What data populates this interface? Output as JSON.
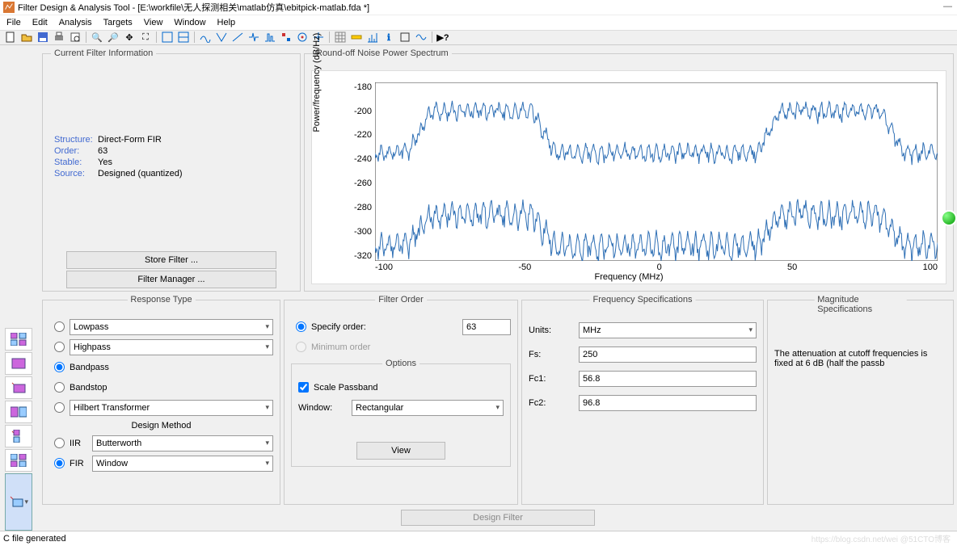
{
  "title": "Filter Design & Analysis Tool -   [E:\\workfile\\无人探测相关\\matlab仿真\\ebitpick-matlab.fda *]",
  "menu": [
    "File",
    "Edit",
    "Analysis",
    "Targets",
    "View",
    "Window",
    "Help"
  ],
  "cfi": {
    "title": "Current Filter Information",
    "structure_k": "Structure:",
    "structure_v": "Direct-Form FIR",
    "order_k": "Order:",
    "order_v": "63",
    "stable_k": "Stable:",
    "stable_v": "Yes",
    "source_k": "Source:",
    "source_v": "Designed (quantized)",
    "store": "Store Filter ...",
    "manager": "Filter Manager ..."
  },
  "plot": {
    "title": "Round-off Noise Power Spectrum",
    "ylab": "Power/frequency (dB/Hz)",
    "xlab": "Frequency (MHz)"
  },
  "rt": {
    "title": "Response Type",
    "lowpass": "Lowpass",
    "highpass": "Highpass",
    "bandpass": "Bandpass",
    "bandstop": "Bandstop",
    "hilbert": "Hilbert Transformer",
    "design_method": "Design Method",
    "iir": "IIR",
    "iir_v": "Butterworth",
    "fir": "FIR",
    "fir_v": "Window"
  },
  "fo": {
    "title": "Filter Order",
    "specify": "Specify order:",
    "specify_v": "63",
    "min": "Minimum order",
    "opts": "Options",
    "scale": "Scale Passband",
    "window": "Window:",
    "window_v": "Rectangular",
    "view": "View"
  },
  "fs": {
    "title": "Frequency Specifications",
    "units": "Units:",
    "units_v": "MHz",
    "fs_l": "Fs:",
    "fs_v": "250",
    "fc1": "Fc1:",
    "fc1_v": "56.8",
    "fc2": "Fc2:",
    "fc2_v": "96.8"
  },
  "ms": {
    "title": "Magnitude Specifications",
    "text": "The attenuation at cutoff frequencies is fixed at 6 dB (half the passb"
  },
  "design": "Design Filter",
  "status": "C file generated",
  "watermark": "https://blog.csdn.net/wei @51CTO博客",
  "chart_data": {
    "type": "line",
    "xlabel": "Frequency (MHz)",
    "ylabel": "Power/frequency (dB/Hz)",
    "xlim": [
      -125,
      125
    ],
    "ylim": [
      -330,
      -175
    ],
    "yticks": [
      -180,
      -200,
      -220,
      -240,
      -260,
      -280,
      -300,
      -320
    ],
    "xticks": [
      -100,
      -50,
      0,
      50,
      100
    ],
    "series": [
      {
        "name": "upper",
        "desc": "Upper noise envelope",
        "approx": [
          {
            "x": -125,
            "y": -220
          },
          {
            "x": -100,
            "y": -190
          },
          {
            "x": -60,
            "y": -190
          },
          {
            "x": -50,
            "y": -225
          },
          {
            "x": 50,
            "y": -225
          },
          {
            "x": 60,
            "y": -190
          },
          {
            "x": 100,
            "y": -190
          },
          {
            "x": 125,
            "y": -220
          }
        ]
      },
      {
        "name": "lower",
        "desc": "Lower noise envelope",
        "approx": [
          {
            "x": -125,
            "y": -300
          },
          {
            "x": -100,
            "y": -280
          },
          {
            "x": -60,
            "y": -280
          },
          {
            "x": -50,
            "y": -300
          },
          {
            "x": 50,
            "y": -300
          },
          {
            "x": 60,
            "y": -280
          },
          {
            "x": 100,
            "y": -280
          },
          {
            "x": 125,
            "y": -300
          }
        ]
      }
    ]
  }
}
